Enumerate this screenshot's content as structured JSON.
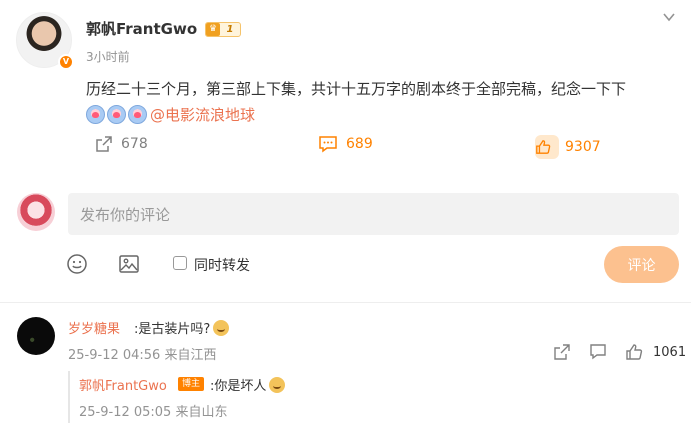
{
  "post": {
    "author": "郭帆FrantGwo",
    "level": "1",
    "time": "3小时前",
    "content": "历经二十三个月，第三部上下集，共计十五万字的剧本终于全部完稿，纪念一下下",
    "mention": "@电影流浪地球",
    "emoji_count": 3,
    "stats": {
      "reposts": "678",
      "comments": "689",
      "likes": "9307"
    }
  },
  "composer": {
    "placeholder": "发布你的评论",
    "repost_label": "同时转发",
    "submit_label": "评论"
  },
  "comments": [
    {
      "name": "岁岁糖果",
      "text": ":是古装片吗?",
      "meta": "25-9-12 04:56 来自江西",
      "likes": "1061",
      "reply": {
        "name": "郭帆FrantGwo",
        "badge": "博主",
        "text": ":你是坏人",
        "meta": "25-9-12 05:05 来自山东"
      }
    }
  ],
  "colors": {
    "accent": "#ff8200",
    "link": "#eb7350",
    "muted": "#939393",
    "submit_disabled": "#fcc18f"
  }
}
